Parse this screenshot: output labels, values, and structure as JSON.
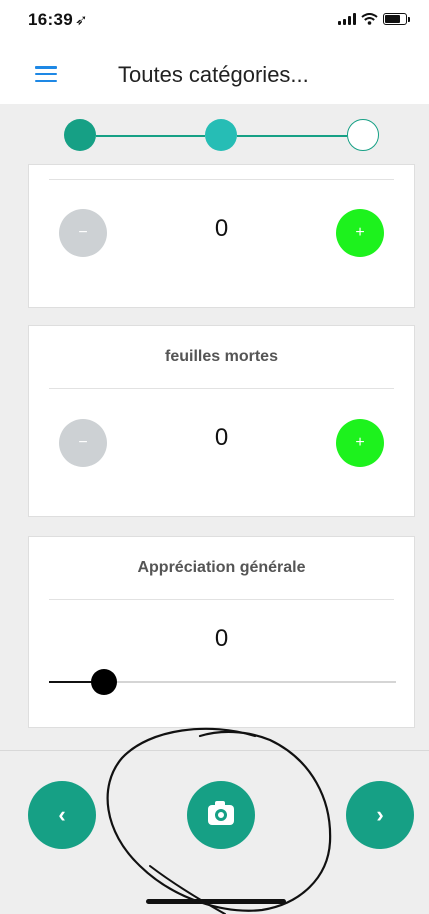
{
  "status_bar": {
    "time": "16:39",
    "location_glyph": "➶"
  },
  "header": {
    "title": "Toutes catégories...",
    "menu_icon": "hamburger-icon"
  },
  "stepper": {
    "steps": 3,
    "current_step": 2
  },
  "cards": [
    {
      "title": "",
      "value": "0",
      "minus_label": "−",
      "plus_label": "+"
    },
    {
      "title": "feuilles mortes",
      "value": "0",
      "minus_label": "−",
      "plus_label": "+"
    },
    {
      "title": "Appréciation générale",
      "value": "0",
      "slider_level": 0
    }
  ],
  "bottom_nav": {
    "prev_label": "‹",
    "next_label": "›",
    "camera_icon": "camera-icon"
  },
  "colors": {
    "primary": "#16a085",
    "step_active": "#26bdb5",
    "plus": "#1df21d",
    "minus": "#cdd1d4",
    "menu": "#1e88e5"
  }
}
